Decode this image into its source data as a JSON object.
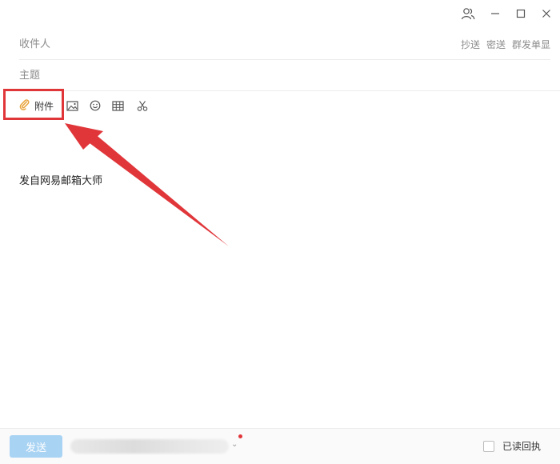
{
  "window": {
    "contacts_icon": "contacts-icon",
    "minimize_icon": "minimize-icon",
    "maximize_icon": "maximize-icon",
    "close_icon": "close-icon"
  },
  "compose": {
    "recipient_placeholder": "收件人",
    "subject_placeholder": "主题",
    "cc_label": "抄送",
    "bcc_label": "密送",
    "separate_label": "群发单显"
  },
  "toolbar": {
    "attach_label": "附件",
    "attach_icon": "paperclip-icon",
    "image_icon": "image-icon",
    "emoji_icon": "emoji-icon",
    "table_icon": "table-icon",
    "screenshot_icon": "scissors-icon"
  },
  "editor": {
    "signature": "发自网易邮箱大师"
  },
  "footer": {
    "send_label": "发送",
    "read_receipt_label": "已读回执"
  },
  "colors": {
    "highlight": "#e0363a",
    "send_button": "#a9d3f3",
    "attach_icon": "#e8a33d"
  }
}
